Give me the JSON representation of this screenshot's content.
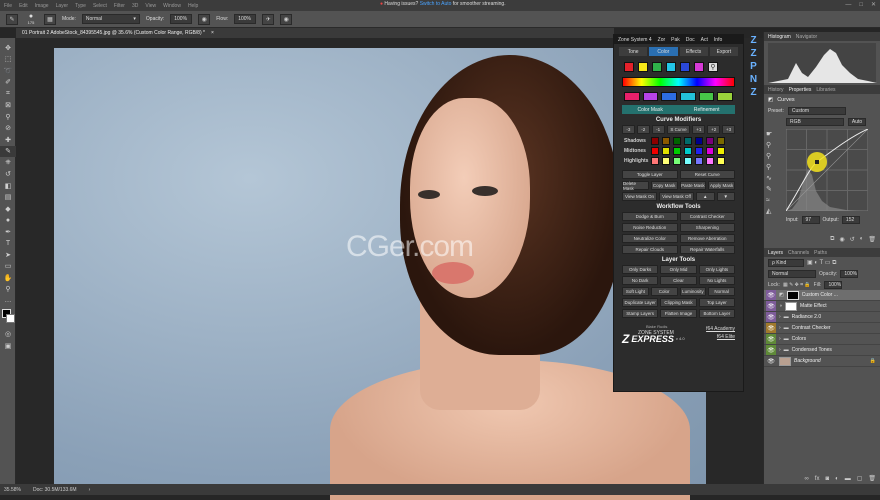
{
  "menubar": {
    "items": [
      "File",
      "Edit",
      "Image",
      "Layer",
      "Type",
      "Select",
      "Filter",
      "3D",
      "View",
      "Window",
      "Help"
    ],
    "notice_prefix": "Having issues?",
    "notice_link": "Switch to Auto",
    "notice_suffix": "for smoother streaming.",
    "minimize": "—",
    "maximize": "□",
    "close": "✕"
  },
  "options": {
    "brush_size": "175",
    "mode_label": "Mode:",
    "mode_value": "Normal",
    "opacity_label": "Opacity:",
    "opacity_value": "100%",
    "flow_label": "Flow:",
    "flow_value": "100%"
  },
  "doc": {
    "tab": "01 Portrait 2 AdobeStock_84395545.jpg @ 35.6% (Custom Color Range, RGB/8) *",
    "close": "×"
  },
  "watermark": "CGer.com",
  "status": {
    "zoom": "35.58%",
    "doc": "Doc: 30.5M/133.6M"
  },
  "zs": {
    "title": "Zone System 4",
    "title_tabs": [
      "Zor",
      "Pak",
      "Doc",
      "Act",
      "Info"
    ],
    "tabs": [
      "Tone",
      "Color",
      "Effects",
      "Export"
    ],
    "active_tab": "Color",
    "color_mask": "Color Mask",
    "refinement": "Refinement",
    "curve_modifiers": "Curve Modifiers",
    "mod_buttons": [
      "-3",
      "-2",
      "-1",
      "S Curve",
      "+1",
      "+2",
      "+3"
    ],
    "row_labels": [
      "Shadows",
      "Midtones",
      "Highlights"
    ],
    "buttons1": [
      [
        "Toggle Layer",
        "Reset Curve"
      ],
      [
        "Delete Mask",
        "Copy Mask",
        "Paste Mask",
        "Apply Mask"
      ],
      [
        "View Mask On",
        "View Mask Off",
        "▲",
        "▼"
      ]
    ],
    "workflow": "Workflow Tools",
    "buttons2": [
      [
        "Dodge & Burn",
        "Contrast Checker"
      ],
      [
        "Noise Reduction",
        "Sharpening"
      ],
      [
        "Neutralize Color",
        "Remove Aberration"
      ],
      [
        "Repair Clouds",
        "Repair Waterfalls"
      ]
    ],
    "layer_tools": "Layer Tools",
    "buttons3": [
      [
        "Only Darks",
        "Only Mid",
        "Only Lights"
      ],
      [
        "No Dark",
        "Clear",
        "No Lights"
      ],
      [
        "Soft Light",
        "Color",
        "Luminosity",
        "Normal"
      ],
      [
        "Duplicate Layer",
        "Clipping Mask",
        "Top Layer"
      ],
      [
        "Stamp Layers",
        "Flatten Image",
        "Bottom Layer"
      ]
    ],
    "logo_top": "Blake Rudis",
    "logo_main": "ZONE SYSTEM",
    "logo_express": "EXPRESS",
    "logo_ver": "v 4.0",
    "academy": "f64 Academy",
    "elite": "f64 Elite"
  },
  "zs_icons": [
    "Z",
    "Z",
    "P",
    "N",
    "Z"
  ],
  "histogram": {
    "tabs": [
      "Histogram",
      "Navigator"
    ]
  },
  "properties": {
    "tabs": [
      "History",
      "Properties",
      "Libraries"
    ],
    "title": "Curves",
    "preset_label": "Preset:",
    "preset_value": "Custom",
    "channel": "RGB",
    "auto": "Auto",
    "input_label": "Input:",
    "input_value": "97",
    "output_label": "Output:",
    "output_value": "152"
  },
  "layers": {
    "tabs": [
      "Layers",
      "Channels",
      "Paths"
    ],
    "kind": "ρ Kind",
    "blend": "Normal",
    "opacity_label": "Opacity:",
    "opacity_value": "100%",
    "lock_label": "Lock:",
    "fill_label": "Fill:",
    "fill_value": "100%",
    "items": [
      "Custom Color ...",
      "Matte Effect",
      "Radiance 2.0",
      "Contrast Checker",
      "Colors",
      "Condensed Tones",
      "Background"
    ]
  },
  "colors": {
    "accent": "#2a6fb2",
    "panel": "#535353"
  }
}
